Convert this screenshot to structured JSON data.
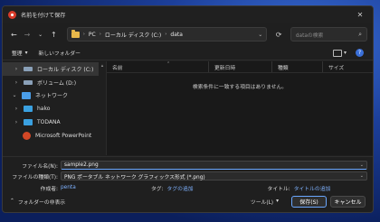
{
  "window": {
    "title": "名前を付けて保存",
    "close_icon": "close-icon",
    "accent": "#6aa7ff"
  },
  "nav": {
    "address": {
      "crumbs": [
        "PC",
        "ローカル ディスク (C:)",
        "data"
      ]
    },
    "search": {
      "placeholder": "dataの検索"
    }
  },
  "toolbar": {
    "organize": "整理",
    "new_folder": "新しいフォルダー"
  },
  "sidebar": {
    "items": [
      {
        "label": "ローカル ディスク (C:)",
        "icon": "drive-icon",
        "selected": true
      },
      {
        "label": "ボリューム (D:)",
        "icon": "drive-icon"
      },
      {
        "label": "ネットワーク",
        "icon": "network-icon"
      },
      {
        "label": "hako",
        "icon": "computer-icon"
      },
      {
        "label": "TODANA",
        "icon": "computer-icon"
      },
      {
        "label": "Microsoft PowerPoint",
        "icon": "powerpoint-icon"
      }
    ]
  },
  "filelist": {
    "columns": [
      "名前",
      "更新日時",
      "種類",
      "サイズ"
    ],
    "empty_message": "検索条件に一致する項目はありません。"
  },
  "form": {
    "filename_label": "ファイル名(N):",
    "filename_value": "sample2.png",
    "filetype_label": "ファイルの種類(T):",
    "filetype_value": "PNG ポータブル ネットワーク グラフィックス形式 (*.png)",
    "author_label": "作成者:",
    "author_value": "penta",
    "tags_label": "タグ:",
    "tags_value": "タグの追加",
    "title_label": "タイトル:",
    "title_value": "タイトルの追加"
  },
  "footer": {
    "hide_folders": "フォルダーの非表示",
    "tools": "ツール(L)",
    "save": "保存(S)",
    "cancel": "キャンセル"
  }
}
